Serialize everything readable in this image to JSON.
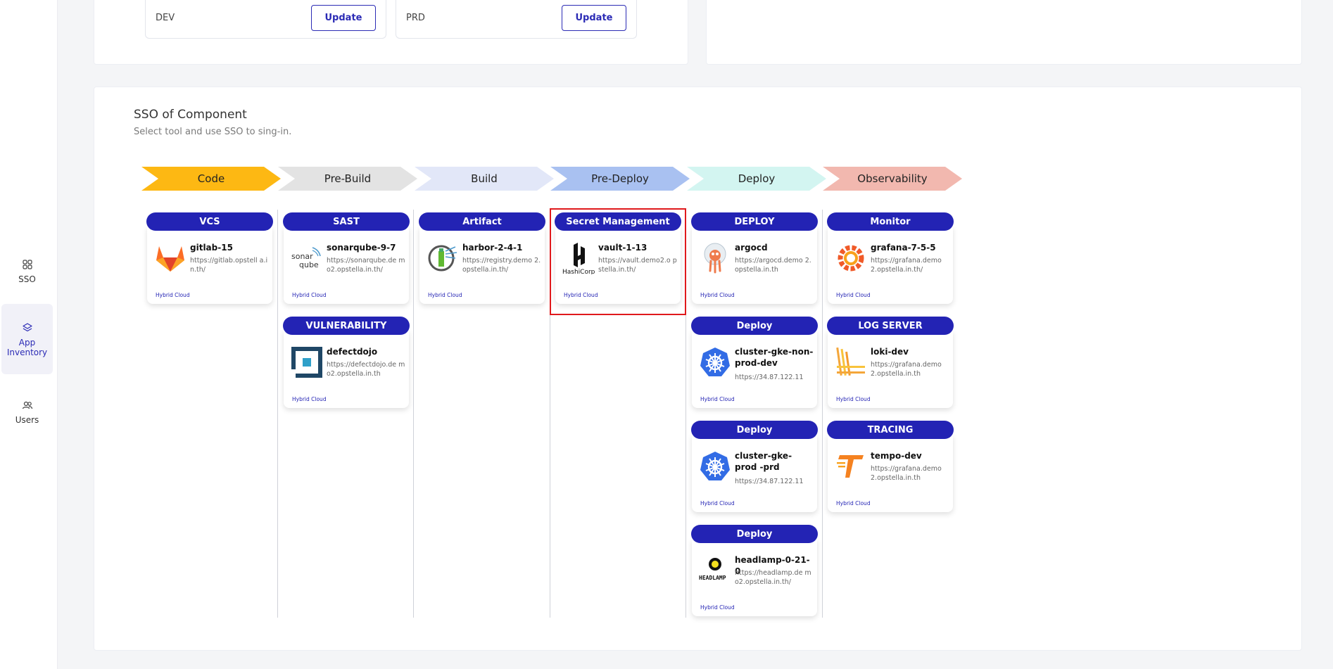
{
  "sidebar": {
    "items": [
      {
        "label": "SSO",
        "icon": "grid-icon"
      },
      {
        "label": "App Inventory",
        "icon": "layers-icon",
        "active": true
      },
      {
        "label": "Users",
        "icon": "users-icon"
      }
    ]
  },
  "environments": [
    {
      "name": "DEV",
      "button": "Update"
    },
    {
      "name": "PRD",
      "button": "Update"
    }
  ],
  "sso_section": {
    "title": "SSO of Component",
    "subtitle": "Select tool and use SSO to sing-in."
  },
  "stages": [
    {
      "label": "Code",
      "color": "#FDB813"
    },
    {
      "label": "Pre-Build",
      "color": "#E3E3E3"
    },
    {
      "label": "Build",
      "color": "#E2E7F8"
    },
    {
      "label": "Pre-Deploy",
      "color": "#A9C1F1"
    },
    {
      "label": "Deploy",
      "color": "#D3F5F1"
    },
    {
      "label": "Observability",
      "color": "#F2B8AF"
    }
  ],
  "tools": {
    "vcs": {
      "header": "VCS",
      "name": "gitlab-15",
      "url": "https://gitlab.opstell a.in.th/",
      "badge": "Hybrid Cloud",
      "icon": "gitlab-icon"
    },
    "sast": {
      "header": "SAST",
      "name": "sonarqube-9-7",
      "url": "https://sonarqube.de mo2.opstella.in.th/",
      "badge": "Hybrid Cloud",
      "icon": "sonarqube-icon"
    },
    "vulnerability": {
      "header": "VULNERABILITY",
      "name": "defectdojo",
      "url": "https://defectdojo.de mo2.opstella.in.th",
      "badge": "Hybrid Cloud",
      "icon": "defectdojo-icon"
    },
    "artifact": {
      "header": "Artifact",
      "name": "harbor-2-4-1",
      "url": "https://registry.demo 2.opstella.in.th/",
      "badge": "Hybrid Cloud",
      "icon": "harbor-icon"
    },
    "secret": {
      "header": "Secret Management",
      "name": "vault-1-13",
      "url": "https://vault.demo2.o pstella.in.th/",
      "badge": "Hybrid Cloud",
      "icon": "hashicorp-icon",
      "logo_text": "HashiCorp"
    },
    "deploy1": {
      "header": "DEPLOY",
      "name": "argocd",
      "url": "https://argocd.demo 2.opstella.in.th",
      "badge": "Hybrid Cloud",
      "icon": "argocd-icon"
    },
    "deploy2": {
      "header": "Deploy",
      "name": "cluster-gke-non-prod-dev",
      "url": "https://34.87.122.11",
      "badge": "Hybrid Cloud",
      "icon": "kubernetes-icon"
    },
    "deploy3": {
      "header": "Deploy",
      "name": "cluster-gke-prod -prd",
      "url": "https://34.87.122.11",
      "badge": "Hybrid Cloud",
      "icon": "kubernetes-icon"
    },
    "deploy4": {
      "header": "Deploy",
      "name": "headlamp-0-21-0",
      "url": "https://headlamp.de mo2.opstella.in.th/",
      "badge": "Hybrid Cloud",
      "icon": "headlamp-icon",
      "logo_text": "HEADLAMP"
    },
    "monitor": {
      "header": "Monitor",
      "name": "grafana-7-5-5",
      "url": "https://grafana.demo 2.opstella.in.th/",
      "badge": "Hybrid Cloud",
      "icon": "grafana-icon"
    },
    "logserver": {
      "header": "LOG SERVER",
      "name": "loki-dev",
      "url": "https://grafana.demo 2.opstella.in.th",
      "badge": "Hybrid Cloud",
      "icon": "loki-icon"
    },
    "tracing": {
      "header": "TRACING",
      "name": "tempo-dev",
      "url": "https://grafana.demo 2.opstella.in.th",
      "badge": "Hybrid Cloud",
      "icon": "tempo-icon"
    }
  }
}
